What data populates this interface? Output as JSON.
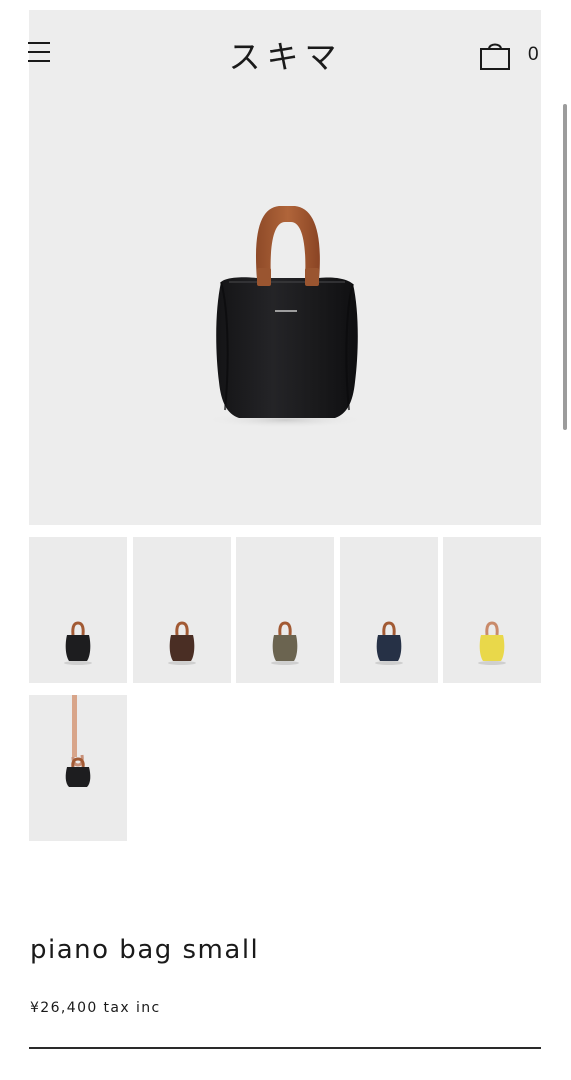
{
  "header": {
    "logo": "スキマ",
    "cart_count": "0",
    "menu_icon": "hamburger-menu-icon",
    "cart_icon": "shopping-bag-icon"
  },
  "gallery": {
    "main_image_alt": "piano bag small black",
    "thumbnails": [
      {
        "color_name": "black",
        "bag_color": "#1d1d1f"
      },
      {
        "color_name": "brown",
        "bag_color": "#4a2e24"
      },
      {
        "color_name": "olive",
        "bag_color": "#6b6450"
      },
      {
        "color_name": "navy",
        "bag_color": "#263146"
      },
      {
        "color_name": "yellow",
        "bag_color": "#e9d84a"
      },
      {
        "color_name": "black-model",
        "bag_color": "#1d1d1f"
      }
    ]
  },
  "product": {
    "name": "piano bag small",
    "price": "¥26,400 tax inc"
  },
  "colors": {
    "background": "#ededed",
    "handle": "#a25a34",
    "bag_main": "#1d1d1f"
  }
}
